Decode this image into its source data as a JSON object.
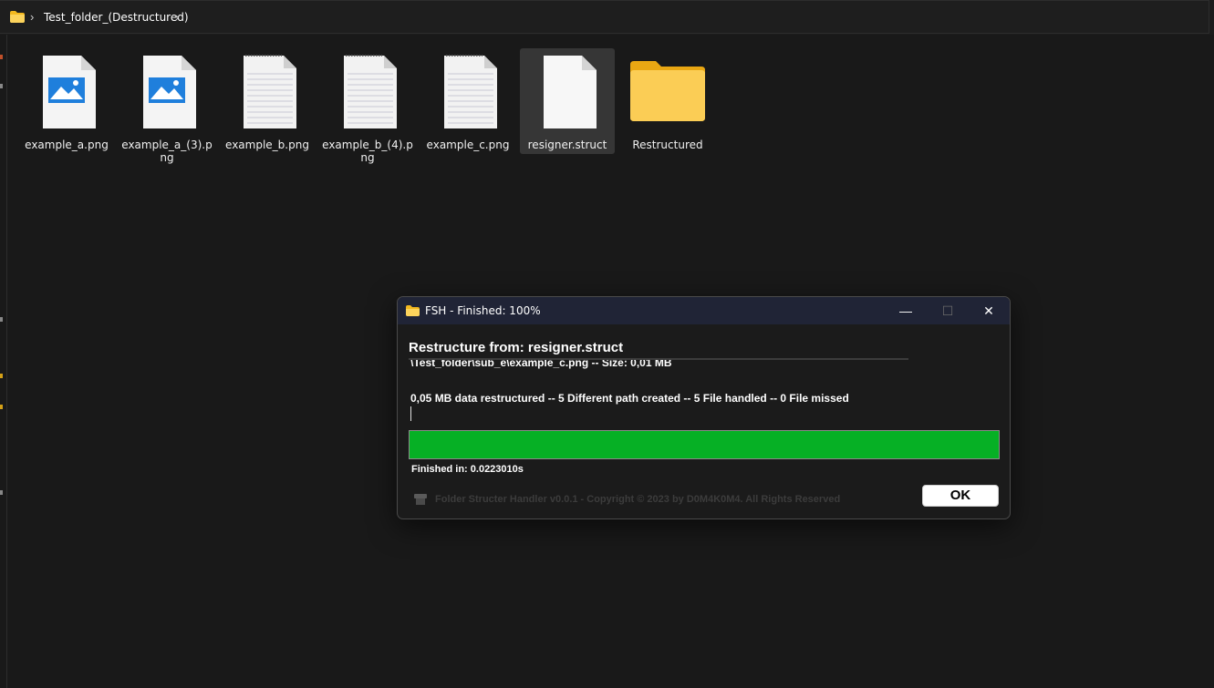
{
  "address_bar": {
    "breadcrumb": "Test_folder_(Destructured)",
    "separator": "›"
  },
  "files": [
    {
      "name": "example_a.png",
      "icon": "image-icon"
    },
    {
      "name": "example_a_(3).png",
      "icon": "image-icon"
    },
    {
      "name": "example_b.png",
      "icon": "document-icon"
    },
    {
      "name": "example_b_(4).png",
      "icon": "document-icon"
    },
    {
      "name": "example_c.png",
      "icon": "document-icon"
    },
    {
      "name": "resigner.struct",
      "icon": "blank-file-icon",
      "selected": true
    },
    {
      "name": "Restructured",
      "icon": "folder-icon"
    }
  ],
  "dialog": {
    "title": "FSH - Finished: 100%",
    "minimize": "—",
    "maximize": "☐",
    "close": "✕",
    "heading": "Restructure from: resigner.struct",
    "current_path": "\\Test_folder\\sub_e\\example_c.png -- Size: 0,01 MB",
    "summary": "0,05 MB data restructured -- 5 Different path created -- 5 File handled -- 0 File missed",
    "progress": 1.0,
    "finished": "Finished in: 0.0223010s",
    "footer": "Folder Structer Handler v0.0.1 - Copyright © 2023 by D0M4K0M4. All Rights Reserved",
    "ok_label": "OK"
  },
  "colors": {
    "progress": "#06b025",
    "titlebar": "#202436",
    "folder": "#f8c94a"
  }
}
